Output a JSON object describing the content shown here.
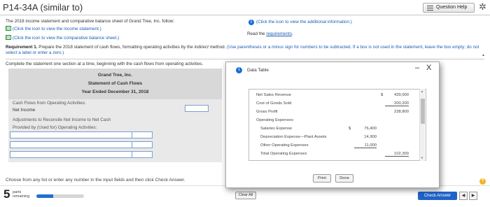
{
  "header": {
    "title": "P14-34A (similar to)",
    "help_label": "Question Help",
    "settings_icon": "gear-icon"
  },
  "intro": {
    "text": "The 2018 income statement and comparative balance sheet of Grand Tree, Inc. follow:",
    "link_income": "(Click the icon to view the income statement.)",
    "link_balance": "(Click the icon to view the comparative balance sheet.)",
    "info_link": "(Click the icon to view the additional information.)",
    "read_prefix": "Read the ",
    "read_link": "requirements",
    "read_suffix": "."
  },
  "requirement": {
    "bold": "Requirement 1.",
    "text": " Prepare the 2018 statement of cash flows, formatting operating activities by the ",
    "italic": "indirect",
    "text2": " method. ",
    "blue": "(Use parentheses or a minus sign for numbers to be subtracted. If a box is not used in the statement, leave the box empty; do not select a label or enter a zero.)"
  },
  "instruction": "Complete the statement one section at a time, beginning with the cash flows from operating activities.",
  "statement": {
    "company": "Grand Tree, Inc.",
    "name": "Statement of Cash Flows",
    "period": "Year Ended December 31, 2018",
    "rows": {
      "cfo": "Cash Flows from Operating Activities:",
      "net_income": "Net Income",
      "adjustments": "Adjustments to Reconcile Net Income to Net Cash",
      "provided": "Provided by (Used for) Operating Activities:"
    },
    "net_income_value": ""
  },
  "hint": "Choose from any list or enter any number in the input fields and then click Check Answer.",
  "footer": {
    "parts_count": "5",
    "parts_label_1": "parts",
    "parts_label_2": "remaining",
    "progress": 0.35,
    "clear_all": "Clear All",
    "check_answer": "Check Answer",
    "prev": "◀",
    "next": "▶"
  },
  "modal": {
    "title": "Data Table",
    "minimize": "–",
    "close": "X",
    "rows": [
      {
        "label": "Net Sales Revenue",
        "dollar_right": "$",
        "right": "439,000"
      },
      {
        "label": "Cost of Goods Sold",
        "right": "200,200"
      },
      {
        "label": "Gross Profit",
        "right": "238,800"
      },
      {
        "label": "Operating Expenses:"
      },
      {
        "label": "Salaries Expense",
        "dollar_mid": "$",
        "mid": "76,400"
      },
      {
        "label": "Depreciation Expense—Plant Assets",
        "mid": "14,900"
      },
      {
        "label": "Other Operating Expenses",
        "mid": "11,000"
      },
      {
        "label": "Total Operating Expenses",
        "right": "102,300"
      }
    ],
    "print_label": "Print",
    "done_label": "Done"
  },
  "colors": {
    "accent": "#1f63c9",
    "link": "#1a5db5",
    "help": "#f2b51f"
  }
}
